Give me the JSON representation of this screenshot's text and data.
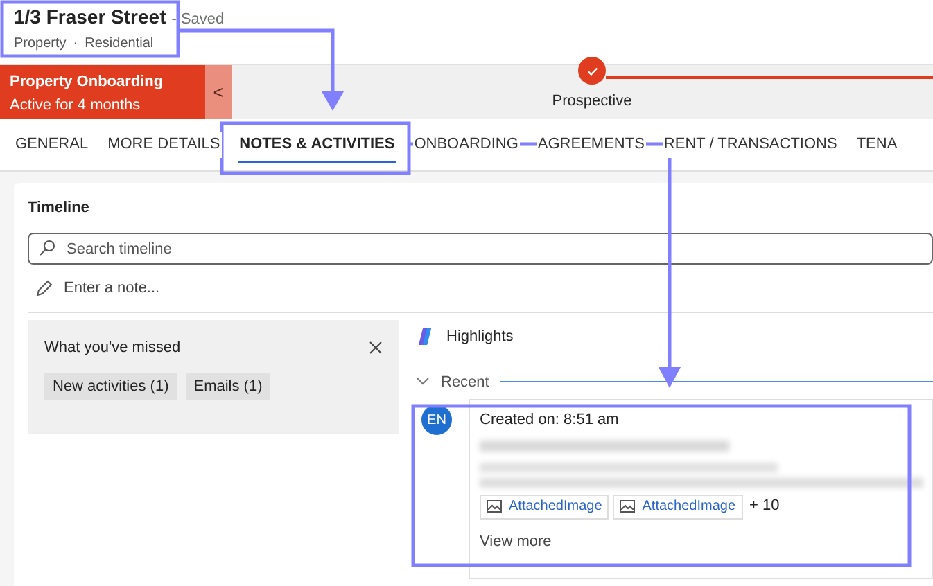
{
  "record": {
    "title": "1/3 Fraser Street",
    "save_status": "- Saved",
    "entity": "Property",
    "separator": "·",
    "type": "Residential"
  },
  "process": {
    "name": "Property Onboarding",
    "duration": "Active for 4 months",
    "collapse_glyph": "<",
    "stage": {
      "label": "Prospective",
      "completed": true
    }
  },
  "tabs": [
    {
      "label": "GENERAL",
      "selected": false
    },
    {
      "label": "MORE DETAILS",
      "selected": false
    },
    {
      "label": "NOTES & ACTIVITIES",
      "selected": true
    },
    {
      "label": "ONBOARDING",
      "selected": false
    },
    {
      "label": "AGREEMENTS",
      "selected": false
    },
    {
      "label": "RENT / TRANSACTIONS",
      "selected": false
    },
    {
      "label": "TENA",
      "selected": false
    }
  ],
  "timeline": {
    "title": "Timeline",
    "search": {
      "placeholder": "Search timeline"
    },
    "note": {
      "placeholder": "Enter a note..."
    },
    "missed": {
      "title": "What you've missed",
      "chips": [
        "New activities (1)",
        "Emails (1)"
      ]
    },
    "highlights": "Highlights",
    "section": {
      "label": "Recent",
      "expanded": true
    },
    "entries": [
      {
        "initials": "EN",
        "created": "Created on: 8:51 am",
        "attachments": [
          "AttachedImage",
          "AttachedImage"
        ],
        "more": "+ 10",
        "view_more": "View more"
      }
    ]
  }
}
